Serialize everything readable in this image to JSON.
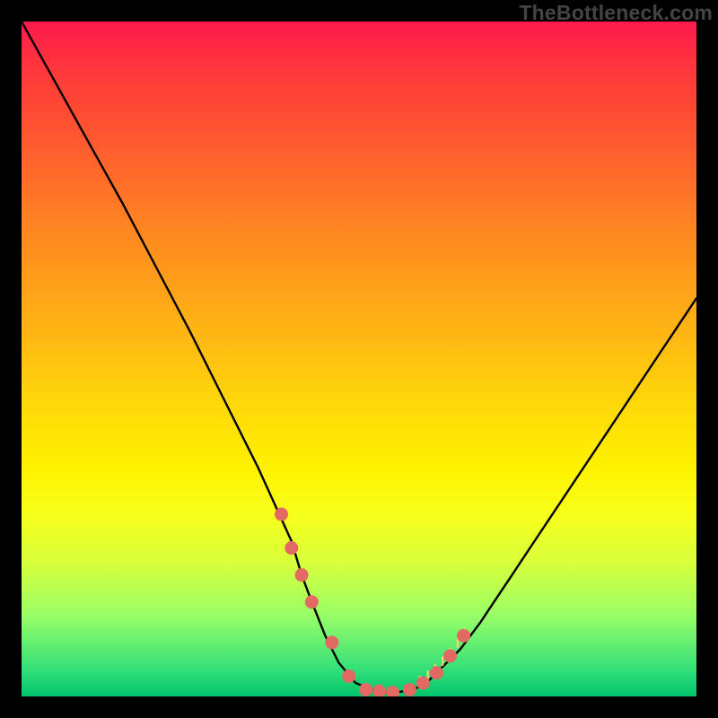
{
  "watermark": "TheBottleneck.com",
  "chart_data": {
    "type": "line",
    "title": "",
    "xlabel": "",
    "ylabel": "",
    "xlim": [
      0,
      100
    ],
    "ylim": [
      0,
      100
    ],
    "series": [
      {
        "name": "curve",
        "x": [
          0,
          5,
          10,
          15,
          20,
          25,
          30,
          35,
          40,
          41.5,
          43,
          45,
          47,
          49.5,
          52,
          55,
          58,
          60,
          62,
          65,
          68,
          70,
          73,
          76,
          80,
          84,
          88,
          92,
          96,
          100
        ],
        "values": [
          100,
          91,
          82,
          73,
          63.5,
          54,
          44,
          34,
          23,
          18,
          14,
          9,
          5,
          2,
          1,
          0.5,
          1,
          2,
          4,
          7,
          11,
          14,
          18.5,
          23,
          29,
          35,
          41,
          47,
          53,
          59
        ]
      }
    ],
    "markers": {
      "name": "highlight-points",
      "color": "#e36a63",
      "x": [
        38.5,
        40,
        41.5,
        43,
        46,
        48.5,
        51,
        53,
        55,
        57.5,
        59.5,
        61.5,
        63.5,
        65.5
      ],
      "values": [
        27,
        22,
        18,
        14,
        8,
        3,
        1,
        0.8,
        0.6,
        1,
        2,
        3.5,
        6,
        9
      ]
    },
    "marker_ticks": {
      "name": "tick-marks",
      "color": "#f5d56a",
      "x": [
        59,
        60.2,
        61.3,
        62.4,
        63.5,
        64.6,
        65.7
      ],
      "values": [
        2,
        2.8,
        3.8,
        4.9,
        6.2,
        7.6,
        9.1
      ]
    }
  }
}
